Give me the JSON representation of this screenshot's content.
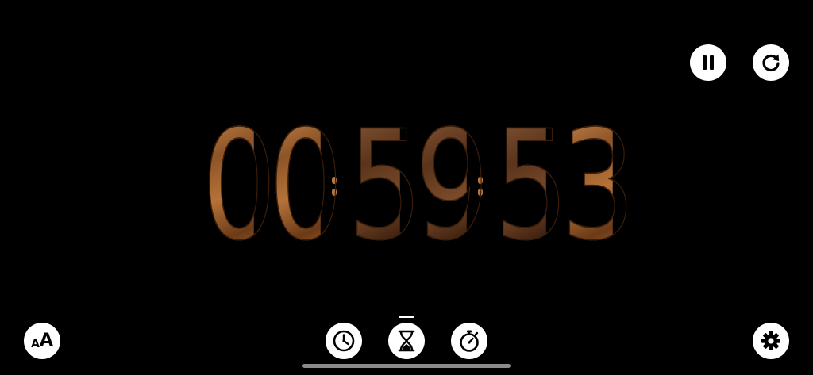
{
  "timer": {
    "digits": [
      "0",
      "0",
      "5",
      "9",
      "5",
      "3"
    ]
  },
  "controls": {
    "text_size_small": "A",
    "text_size_large": "A"
  },
  "icons": {
    "pause": "pause-icon",
    "reset": "reset-icon",
    "text_size": "text-size-icon",
    "clock": "clock-icon",
    "timer": "hourglass-icon",
    "stopwatch": "stopwatch-icon",
    "settings": "gear-icon"
  },
  "colors": {
    "background": "#000000",
    "button": "#ffffff",
    "wood_light": "#c78a4f",
    "wood_dark": "#5a341b"
  },
  "active_mode": "timer"
}
